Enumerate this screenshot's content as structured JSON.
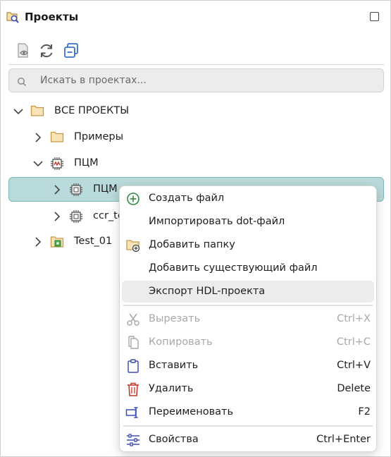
{
  "header": {
    "title": "Проекты"
  },
  "search": {
    "placeholder": "Искать в проектах..."
  },
  "tree": {
    "root_label": "ВСЕ ПРОЕКТЫ",
    "examples_label": "Примеры",
    "pcm_label": "ПЦМ",
    "pcm_child_label": "ПЦМ",
    "ccr_label": "ccr_te",
    "test_label": "Test_01"
  },
  "menu": {
    "create_file": "Создать файл",
    "import_dot": "Импортировать dot-файл",
    "add_folder": "Добавить папку",
    "add_existing": "Добавить существующий файл",
    "export_hdl": "Экспорт HDL-проекта",
    "cut": "Вырезать",
    "cut_shortcut": "Ctrl+X",
    "copy": "Копировать",
    "copy_shortcut": "Ctrl+C",
    "paste": "Вставить",
    "paste_shortcut": "Ctrl+V",
    "delete": "Удалить",
    "delete_shortcut": "Delete",
    "rename": "Переименовать",
    "rename_shortcut": "F2",
    "properties": "Свойства",
    "properties_shortcut": "Ctrl+Enter"
  },
  "colors": {
    "selection": "#b9dada",
    "folder": "#e8c27a",
    "create_green": "#2e8b3e",
    "delete_red": "#c0392b",
    "paste_blue": "#3b4fb8"
  }
}
